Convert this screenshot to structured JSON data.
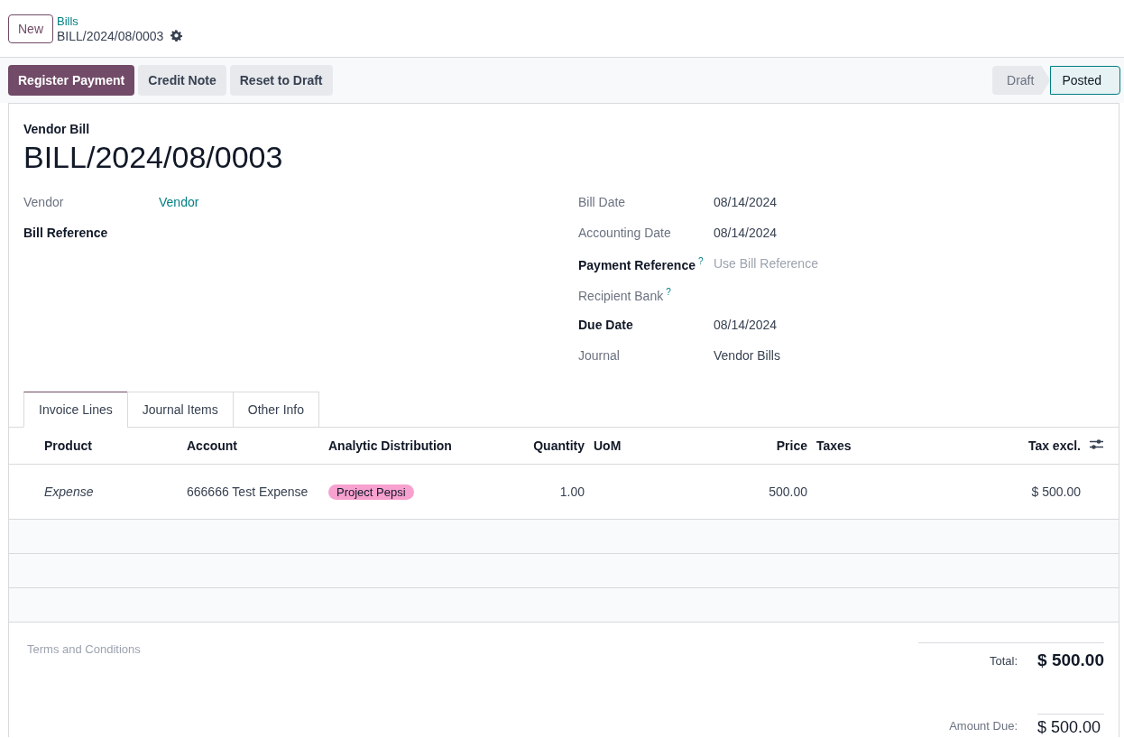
{
  "breadcrumb": {
    "new_button": "New",
    "parent": "Bills",
    "current": "BILL/2024/08/0003"
  },
  "actions": [
    {
      "label": "Register Payment",
      "primary": true
    },
    {
      "label": "Credit Note",
      "primary": false
    },
    {
      "label": "Reset to Draft",
      "primary": false
    }
  ],
  "status_bar": [
    {
      "label": "Draft",
      "selected": false
    },
    {
      "label": "Posted",
      "selected": true
    }
  ],
  "sheet": {
    "type_label": "Vendor Bill",
    "title": "BILL/2024/08/0003",
    "left_fields": [
      {
        "label": "Vendor",
        "required": false,
        "value": "Vendor",
        "link": true
      },
      {
        "label": "Bill Reference",
        "required": true
      }
    ],
    "right_fields": [
      {
        "label": "Bill Date",
        "required": false,
        "value": "08/14/2024"
      },
      {
        "label": "Accounting Date",
        "required": false,
        "value": "08/14/2024"
      },
      {
        "label": "Payment Reference",
        "required": true,
        "help": "?",
        "placeholder": "Use Bill Reference"
      },
      {
        "label": "Recipient Bank",
        "required": false,
        "help": "?"
      },
      {
        "label": "Due Date",
        "required": true,
        "value": "08/14/2024"
      },
      {
        "label": "Journal",
        "required": false,
        "value": "Vendor Bills"
      }
    ]
  },
  "tabs": [
    {
      "label": "Invoice Lines",
      "selected": true
    },
    {
      "label": "Journal Items",
      "selected": false
    },
    {
      "label": "Other Info",
      "selected": false
    }
  ],
  "table": {
    "columns": [
      {
        "label": "Product"
      },
      {
        "label": "Account"
      },
      {
        "label": "Analytic Distribution"
      },
      {
        "label": "Quantity"
      },
      {
        "label": "UoM"
      },
      {
        "label": "Price"
      },
      {
        "label": "Taxes"
      },
      {
        "label": "Tax excl."
      }
    ],
    "rows": [
      {
        "product": "Expense",
        "account": "666666 Test Expense",
        "analytic": [
          {
            "label": "Project Pepsi",
            "color": "#f7a1cf"
          }
        ],
        "quantity": "1.00",
        "price": "500.00",
        "subtotal": "$ 500.00"
      }
    ]
  },
  "terms_placeholder": "Terms and Conditions",
  "totals": [
    {
      "label": "Total:",
      "value": "$ 500.00",
      "kind": "total"
    },
    {
      "label": "Amount Due:",
      "value": "$ 500.00",
      "kind": "due"
    }
  ]
}
